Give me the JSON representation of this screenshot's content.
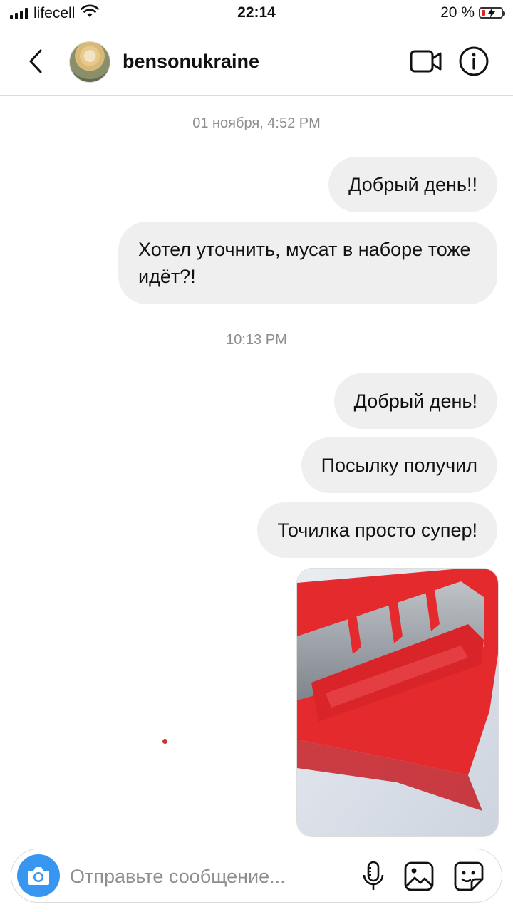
{
  "status_bar": {
    "carrier": "lifecell",
    "time": "22:14",
    "battery": "20 %",
    "battery_level": 0.2,
    "battery_color": "#e02424"
  },
  "header": {
    "username": "bensonukraine",
    "icons": [
      "chevron-left-icon",
      "video-camera-icon",
      "info-icon"
    ]
  },
  "conversation": {
    "timestamps": [
      "01 ноября, 4:52 PM",
      "10:13 PM"
    ],
    "messages": [
      {
        "text": "Добрый день!!"
      },
      {
        "text": "Хотел уточнить, мусат в наборе тоже идёт?!"
      },
      {
        "text": "Добрый день!"
      },
      {
        "text": "Посылку получил"
      },
      {
        "text": "Точилка просто супер!"
      }
    ],
    "photo": {
      "kind": "image",
      "subject": "red knife sharpener"
    }
  },
  "composer": {
    "placeholder": "Отправьте сообщение...",
    "value": "",
    "icons": [
      "camera-icon",
      "microphone-icon",
      "gallery-icon",
      "sticker-icon"
    ]
  },
  "colors": {
    "accent": "#3797f0",
    "bubble": "#efefef",
    "meta_text": "#8e8e8e"
  }
}
